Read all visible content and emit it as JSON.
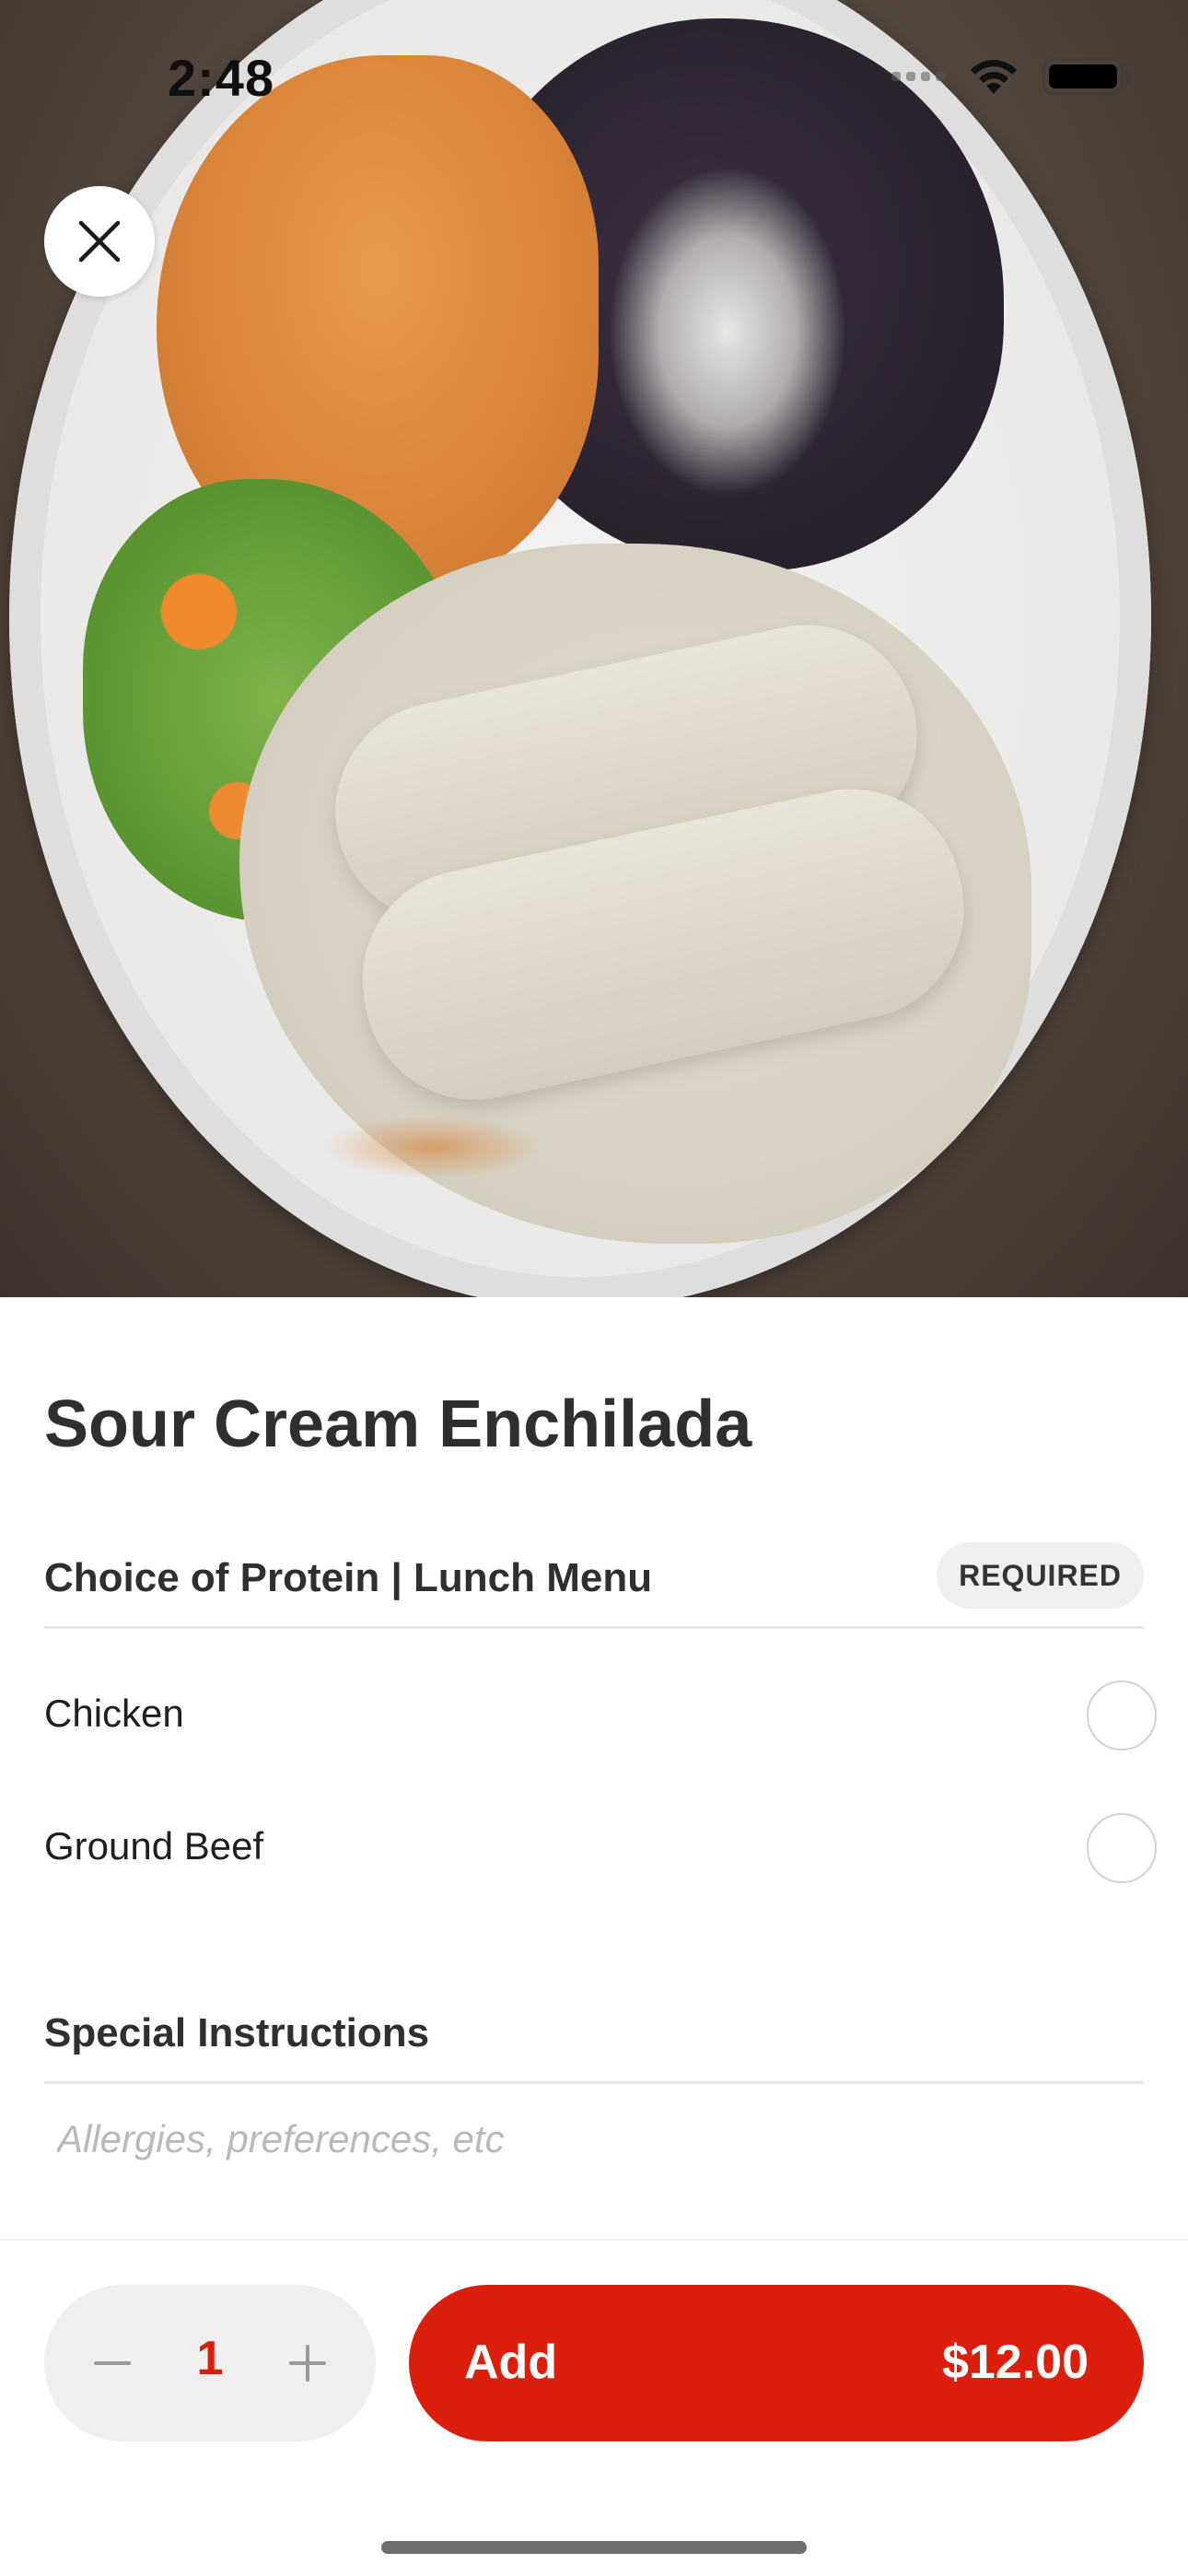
{
  "status_bar": {
    "time": "2:48"
  },
  "hero": {
    "image_alt": "Sour Cream Enchilada plate with rice, black beans and salad"
  },
  "icons": {
    "close": "close-icon",
    "minus": "minus-icon",
    "plus": "plus-icon",
    "wifi": "wifi-icon",
    "battery": "battery-icon",
    "signal": "cellular-signal-icon"
  },
  "item": {
    "title": "Sour Cream Enchilada"
  },
  "modifier_group": {
    "title": "Choice of Protein | Lunch Menu",
    "badge": "REQUIRED",
    "options": [
      {
        "label": "Chicken",
        "selected": false
      },
      {
        "label": "Ground Beef",
        "selected": false
      }
    ]
  },
  "special_instructions": {
    "title": "Special Instructions",
    "placeholder": "Allergies, preferences, etc",
    "value": ""
  },
  "order_bar": {
    "quantity": "1",
    "add_label": "Add",
    "price": "$12.00"
  },
  "colors": {
    "accent": "#dc1f0c",
    "quantity_text": "#d81f0f",
    "badge_bg": "#efefef",
    "stepper_bg": "#efefef"
  }
}
